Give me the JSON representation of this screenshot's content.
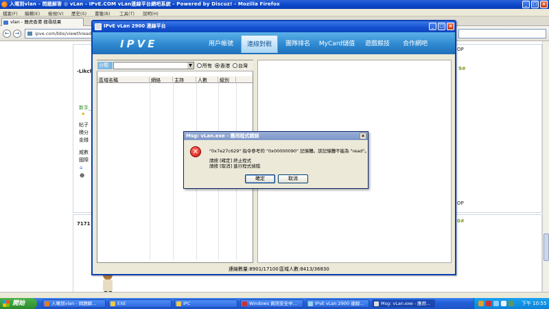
{
  "firefox": {
    "title": "入暱到vlan - 問題解答 ◎ vLan - IPvE.COM vLan連線平台網吧系統 - Powered by Discuz! - Mozilla Firefox",
    "menu": [
      "檔案(F)",
      "編輯(E)",
      "檢視(V)",
      "歷史(S)",
      "書籤(B)",
      "工具(T)",
      "說明(H)"
    ],
    "tab_label": "vlan - 雅虎香港 搜尋結果",
    "url": "ipve.com/bbs/viewthread.p",
    "window_controls": [
      "minimize",
      "maximize",
      "close"
    ]
  },
  "page": {
    "left_labels": [
      "-Likch",
      "新手_",
      "帖子",
      "積分",
      "金錢",
      "威數",
      "國際"
    ],
    "right_texts": [
      "OP",
      "9#",
      "OP",
      "0#"
    ],
    "post_number": "7171"
  },
  "vlan": {
    "title": "IPvE vLan 2900 連線平台",
    "logo": "IPVE",
    "nav": [
      {
        "label": "用戶帳號",
        "active": false
      },
      {
        "label": "連線對戰",
        "active": true
      },
      {
        "label": "團隊排名",
        "active": false
      },
      {
        "label": "MyCard儲值",
        "active": false
      },
      {
        "label": "遊戲競技",
        "active": false
      },
      {
        "label": "合作網吧",
        "active": false
      }
    ],
    "filter": {
      "label": "分類",
      "selected": "",
      "radios": [
        {
          "label": "所有",
          "checked": false
        },
        {
          "label": "香港",
          "checked": true
        },
        {
          "label": "台灣",
          "checked": false
        }
      ]
    },
    "table_headers": [
      "區域名稱",
      "網絡",
      "主持",
      "人數",
      "級別"
    ],
    "status": {
      "connections": "連線數量:8901/17100",
      "area_users": "區域人數:8413/36830"
    }
  },
  "dialog": {
    "title": "Msg: vLan.exe - 應用程式錯誤",
    "message": "\"0x7e27c629\" 指令參考的 \"0x00000090\" 記憶體。該記憶體不能為 \"read\"。",
    "line2": "請按 [確定] 終止程式",
    "line3": "請按 [取消] 進行程式偵錯",
    "ok": "確定",
    "cancel": "取消"
  },
  "taskbar": {
    "start": "開始",
    "tasks": [
      {
        "label": "入暱到vlan - 問題解...",
        "active": false
      },
      {
        "label": "EXE",
        "active": false
      },
      {
        "label": "iPC",
        "active": false
      },
      {
        "label": "Windows 資訊安全中...",
        "active": false
      },
      {
        "label": "IPvE vLan 2900 連線...",
        "active": false
      },
      {
        "label": "Msg: vLan.exe - 應用...",
        "active": true
      }
    ],
    "clock": "下午 10:55"
  },
  "colors": {
    "xp_blue": "#0a46c8",
    "ipve_header": "#2c86cf",
    "error_red": "#d01010",
    "start_green": "#2c8a2c"
  }
}
